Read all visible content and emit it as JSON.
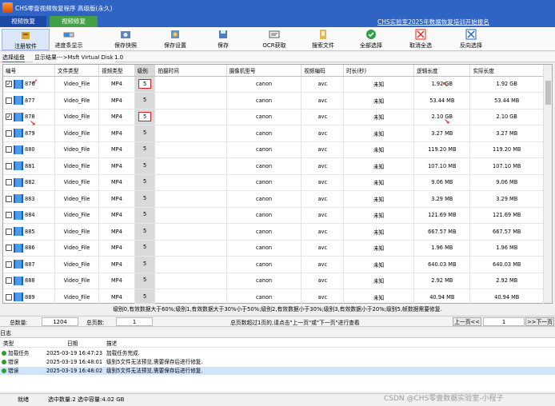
{
  "window": {
    "title": "CHS零壹视频恢复程序 高级版(永久)"
  },
  "tabs": [
    {
      "label": "视频恢复"
    },
    {
      "label": "视频修复"
    }
  ],
  "promo": "CHS实验室2025年数据恢复培训开始报名",
  "toolbar": [
    {
      "label": "注册软件",
      "icon": "key-icon"
    },
    {
      "label": "进度条显示",
      "icon": "progress-icon"
    },
    {
      "label": "保存快照",
      "icon": "snapshot-icon"
    },
    {
      "label": "保存设置",
      "icon": "settings-icon"
    },
    {
      "label": "保存",
      "icon": "save-icon"
    },
    {
      "label": "OCR获取",
      "icon": "ocr-icon"
    },
    {
      "label": "搜索文件",
      "icon": "search-file-icon"
    },
    {
      "label": "全部选择",
      "icon": "select-all-icon"
    },
    {
      "label": "取消全选",
      "icon": "deselect-all-icon"
    },
    {
      "label": "反向选择",
      "icon": "invert-select-icon"
    }
  ],
  "subtabs": {
    "group": "选择组盘",
    "path": "显示结果--->Msft   Virtual Disk",
    "version": "1.0"
  },
  "columns": [
    "编号",
    "文件类型",
    "视频类型",
    "级别",
    "拍摄时间",
    "摄像机型号",
    "视频编码",
    "时长(秒)",
    "逻辑长度",
    "实际长度"
  ],
  "rows": [
    {
      "id": "876",
      "checked": "✓",
      "type": "Video_File",
      "vtype": "MP4",
      "level": "5",
      "time": "",
      "camera": "canon",
      "codec": "avc",
      "duration": "未知",
      "logical": "1.92 GB",
      "actual": "1.92 GB",
      "hl": true
    },
    {
      "id": "877",
      "checked": "",
      "type": "Video_File",
      "vtype": "MP4",
      "level": "5",
      "time": "",
      "camera": "canon",
      "codec": "avc",
      "duration": "未知",
      "logical": "53.44 MB",
      "actual": "53.44 MB"
    },
    {
      "id": "878",
      "checked": "✓",
      "type": "Video_File",
      "vtype": "MP4",
      "level": "5",
      "time": "",
      "camera": "canon",
      "codec": "avc",
      "duration": "未知",
      "logical": "2.10 GB",
      "actual": "2.10 GB",
      "hl": true
    },
    {
      "id": "879",
      "checked": "",
      "type": "Video_File",
      "vtype": "MP4",
      "level": "5",
      "time": "",
      "camera": "canon",
      "codec": "avc",
      "duration": "未知",
      "logical": "3.27 MB",
      "actual": "3.27 MB"
    },
    {
      "id": "880",
      "checked": "",
      "type": "Video_File",
      "vtype": "MP4",
      "level": "5",
      "time": "",
      "camera": "canon",
      "codec": "avc",
      "duration": "未知",
      "logical": "119.20 MB",
      "actual": "119.20 MB"
    },
    {
      "id": "881",
      "checked": "",
      "type": "Video_File",
      "vtype": "MP4",
      "level": "5",
      "time": "",
      "camera": "canon",
      "codec": "avc",
      "duration": "未知",
      "logical": "107.10 MB",
      "actual": "107.10 MB"
    },
    {
      "id": "882",
      "checked": "",
      "type": "Video_File",
      "vtype": "MP4",
      "level": "5",
      "time": "",
      "camera": "canon",
      "codec": "avc",
      "duration": "未知",
      "logical": "9.06 MB",
      "actual": "9.06 MB"
    },
    {
      "id": "883",
      "checked": "",
      "type": "Video_File",
      "vtype": "MP4",
      "level": "5",
      "time": "",
      "camera": "canon",
      "codec": "avc",
      "duration": "未知",
      "logical": "3.29 MB",
      "actual": "3.29 MB"
    },
    {
      "id": "884",
      "checked": "",
      "type": "Video_File",
      "vtype": "MP4",
      "level": "5",
      "time": "",
      "camera": "canon",
      "codec": "avc",
      "duration": "未知",
      "logical": "121.69 MB",
      "actual": "121.69 MB"
    },
    {
      "id": "885",
      "checked": "",
      "type": "Video_File",
      "vtype": "MP4",
      "level": "5",
      "time": "",
      "camera": "canon",
      "codec": "avc",
      "duration": "未知",
      "logical": "667.57 MB",
      "actual": "667.57 MB"
    },
    {
      "id": "886",
      "checked": "",
      "type": "Video_File",
      "vtype": "MP4",
      "level": "5",
      "time": "",
      "camera": "canon",
      "codec": "avc",
      "duration": "未知",
      "logical": "1.96 MB",
      "actual": "1.96 MB"
    },
    {
      "id": "887",
      "checked": "",
      "type": "Video_File",
      "vtype": "MP4",
      "level": "5",
      "time": "",
      "camera": "canon",
      "codec": "avc",
      "duration": "未知",
      "logical": "640.03 MB",
      "actual": "640.03 MB"
    },
    {
      "id": "888",
      "checked": "",
      "type": "Video_File",
      "vtype": "MP4",
      "level": "5",
      "time": "",
      "camera": "canon",
      "codec": "avc",
      "duration": "未知",
      "logical": "2.92 MB",
      "actual": "2.92 MB"
    },
    {
      "id": "889",
      "checked": "",
      "type": "Video_File",
      "vtype": "MP4",
      "level": "5",
      "time": "",
      "camera": "canon",
      "codec": "avc",
      "duration": "未知",
      "logical": "40.94 MB",
      "actual": "40.94 MB"
    }
  ],
  "legend": "级别0,有效数据大于60%;级别1,有效数据大于30%小于50%;级别2,有效数据小于30%;级别3,有效数据小于20%;级别5,帧数据需要修复.",
  "pager": {
    "total_label": "总数量:",
    "total": "1204",
    "pages_label": "总页数:",
    "pages": "1",
    "hint": "总页数超过1页的,请点击\"上一页\"或\"下一页\"进行查看",
    "prev": "上一页<<",
    "current": "1",
    "next": ">>下一页"
  },
  "log": {
    "title": "日志",
    "columns": [
      "类型",
      "日期",
      "描述"
    ],
    "rows": [
      {
        "type": "加载任务",
        "date": "2025-03-19 16:47:23",
        "desc": "加载任务完成."
      },
      {
        "type": "错误",
        "date": "2025-03-19 16:48:01",
        "desc": "级别5文件无法预览,需要保存后进行修复."
      },
      {
        "type": "错误",
        "date": "2025-03-19 16:48:02",
        "desc": "级别5文件无法预览,需要保存后进行修复."
      }
    ]
  },
  "status": {
    "ready": "就绪",
    "selection": "选中数量:2 选中容量:4.02 GB"
  },
  "watermark": "CSDN @CHS零壹数据实验室-小程子",
  "colors": {
    "titlebar": "#2f63c4",
    "accent_green": "#43a047",
    "highlight_red": "#d82020",
    "selected_row": "#cfe3fb"
  }
}
